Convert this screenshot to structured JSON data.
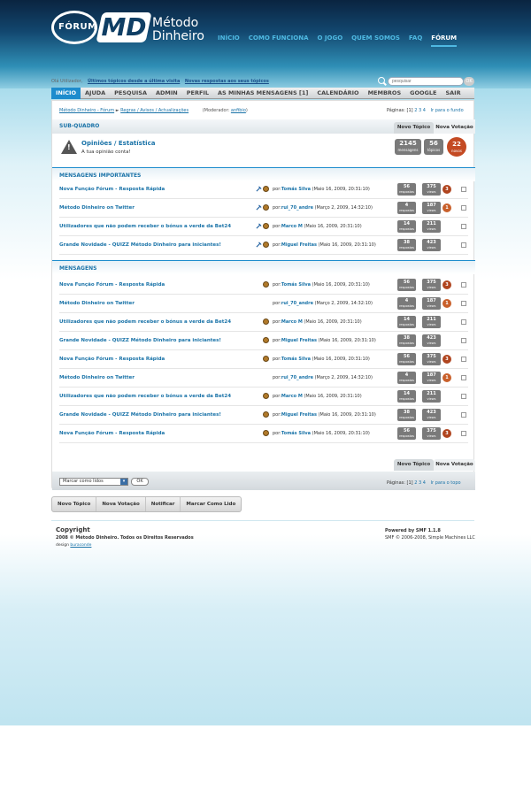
{
  "brand": {
    "bubble": "FÓRUM",
    "md": "MD",
    "line1": "Método",
    "line2": "Dinheiro"
  },
  "top_nav": [
    "INÍCIO",
    "COMO FUNCIONA",
    "O JOGO",
    "QUEM SOMOS",
    "FAQ",
    "FÓRUM"
  ],
  "top_nav_active": "FÓRUM",
  "userbar": {
    "greeting": "Olá Utilizador,",
    "link1": "Últimos tópicos desde a última visita",
    "link2": "Novas respostas aos seus tópicos"
  },
  "search": {
    "placeholder": "pesquisar",
    "button": "OK"
  },
  "main_nav": [
    "INÍCIO",
    "AJUDA",
    "PESQUISA",
    "ADMIN",
    "PERFIL",
    "AS MINHAS MENSAGENS [1]",
    "CALENDÁRIO",
    "MEMBROS",
    "GOOGLE",
    "SAIR"
  ],
  "breadcrumb": {
    "b1": "Método Dinheiro - Fórum",
    "b2": "Regras / Avisos / Actualizações",
    "moderator_prefix": "(Moderador:",
    "moderator": "anfibio",
    "moderator_suffix": ")"
  },
  "pagination": {
    "label": "Páginas:",
    "current": "[1]",
    "p2": "2",
    "p3": "3",
    "p4": "4",
    "bottom_link": "Ir para o fundo",
    "top_link": "Ir para o topo"
  },
  "subboard": {
    "header": "SUB-QUADRO",
    "tab_new_topic": "Novo Tópico",
    "tab_new_poll": "Nova Votação",
    "title": "Opiniões / Estatística",
    "description": "A tua opinião conta!",
    "warning_glyph": "!"
  },
  "sub_stats": [
    {
      "n": "2145",
      "k": "mensagens"
    },
    {
      "n": "56",
      "k": "tópicos"
    },
    {
      "n": "22",
      "k": "novos"
    }
  ],
  "important_header": "MENSAGENS IMPORTANTES",
  "messages_header": "MENSAGENS",
  "by_label": "por:",
  "important_topics": [
    {
      "title": "Nova Função Fórum - Resposta Rápida",
      "user": "Tomás Silva",
      "date": "(Maio 16, 2009, 20:31:10)",
      "replies": "56",
      "views": "375",
      "badge": "3",
      "pin": true
    },
    {
      "title": "Método Dinheiro on Twitter",
      "user": "rui_70_andre",
      "date": "(Março 2, 2009, 14:32:10)",
      "replies": "4",
      "views": "187",
      "badge": "1",
      "pin": true
    },
    {
      "title": "Utilizadores que não podem receber o bónus a verde da Bet24",
      "user": "Marco M",
      "date": "(Maio 16, 2009, 20:31:10)",
      "replies": "14",
      "views": "211",
      "badge": "",
      "pin": true
    },
    {
      "title": "Grande Novidade - QUIZZ Método Dinheiro para iniciantes!",
      "user": "Miguel Freitas",
      "date": "(Maio 16, 2009, 20:31:10)",
      "replies": "38",
      "views": "423",
      "badge": "",
      "pin": true
    }
  ],
  "topics": [
    {
      "title": "Nova Função Fórum - Resposta Rápida",
      "user": "Tomás Silva",
      "date": "(Maio 16, 2009, 20:31:10)",
      "replies": "56",
      "views": "375",
      "badge": "3"
    },
    {
      "title": "Método Dinheiro on Twitter",
      "user": "rui_70_andre",
      "date": "(Março 2, 2009, 14:32:10)",
      "replies": "4",
      "views": "187",
      "badge": "1"
    },
    {
      "title": "Utilizadores que não podem receber o bónus a verde da Bet24",
      "user": "Marco M",
      "date": "(Maio 16, 2009, 20:31:10)",
      "replies": "14",
      "views": "211",
      "badge": ""
    },
    {
      "title": "Grande Novidade - QUIZZ Método Dinheiro para iniciantes!",
      "user": "Miguel Freitas",
      "date": "(Maio 16, 2009, 20:31:10)",
      "replies": "38",
      "views": "423",
      "badge": ""
    },
    {
      "title": "Nova Função Fórum - Resposta Rápida",
      "user": "Tomás Silva",
      "date": "(Maio 16, 2009, 20:31:10)",
      "replies": "56",
      "views": "375",
      "badge": "3"
    },
    {
      "title": "Método Dinheiro on Twitter",
      "user": "rui_70_andre",
      "date": "(Março 2, 2009, 14:32:10)",
      "replies": "4",
      "views": "187",
      "badge": "1"
    },
    {
      "title": "Utilizadores que não podem receber o bónus a verde da Bet24",
      "user": "Marco M",
      "date": "(Maio 16, 2009, 20:31:10)",
      "replies": "14",
      "views": "211",
      "badge": ""
    },
    {
      "title": "Grande Novidade - QUIZZ Método Dinheiro para iniciantes!",
      "user": "Miguel Freitas",
      "date": "(Maio 16, 2009, 20:31:10)",
      "replies": "38",
      "views": "423",
      "badge": ""
    },
    {
      "title": "Nova Função Fórum - Resposta Rápida",
      "user": "Tomás Silva",
      "date": "(Maio 16, 2009, 20:31:10)",
      "replies": "56",
      "views": "375",
      "badge": "3"
    }
  ],
  "count_labels": {
    "replies": "respostas",
    "views": "views"
  },
  "bottom": {
    "tab_new_topic": "Novo Tópico",
    "tab_new_poll": "Nova Votação",
    "select_value": "Marcar como lidos",
    "ok": "OK",
    "dropdown_glyph": "▾"
  },
  "actions": [
    "Novo Tópico",
    "Nova Votação",
    "Notificar",
    "Marcar Como Lido"
  ],
  "footer": {
    "copyright_title": "Copyright",
    "copyright_text": "2008 © Método Dinheiro. Todos os Direitos Reservados",
    "design_label": "design",
    "design_link": "buraconde",
    "powered": "Powered by SMF 1.1.8",
    "smf": "SMF © 2006-2008, Simple Machines LLC"
  },
  "colors": {
    "accent": "#1d8ccd",
    "link": "#1a73a8",
    "badge_orange": "#c44a23",
    "count_grey": "#7a7a7a"
  }
}
